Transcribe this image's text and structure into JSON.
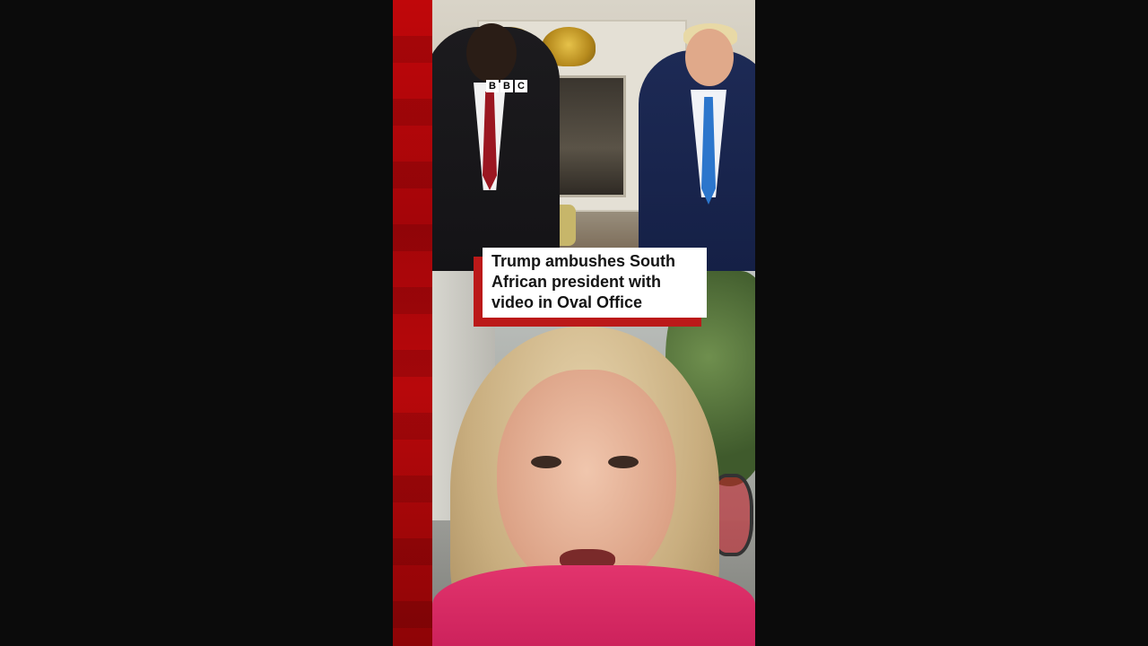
{
  "video": {
    "brand_logo": [
      "B",
      "B",
      "C"
    ],
    "headline": "Trump ambushes South\nAfrican president with\nvideo in Oval Office"
  },
  "colors": {
    "accent_red": "#bb1919",
    "background": "#0b0b0b",
    "caption_bg": "#ffffff"
  }
}
